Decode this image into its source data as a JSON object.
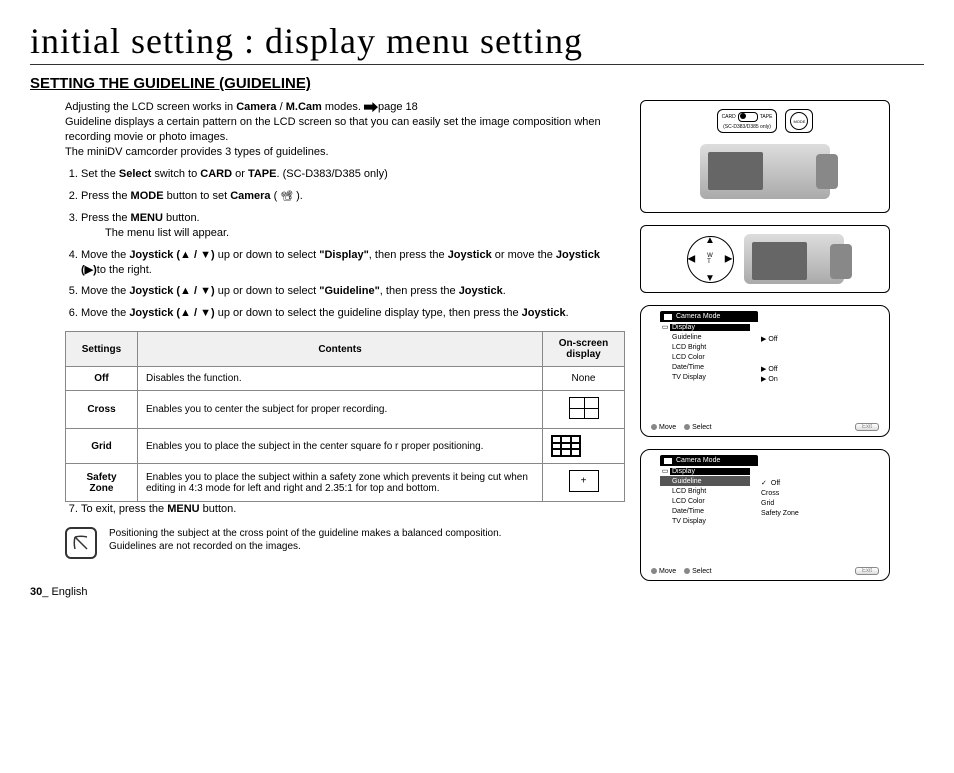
{
  "page_title": "initial setting : display menu setting",
  "section_title": "SETTING THE GUIDELINE (GUIDELINE)",
  "intro": {
    "l1a": "Adjusting the LCD screen works in ",
    "l1b": "Camera",
    "l1c": " / ",
    "l1d": "M.Cam",
    "l1e": " modes. ",
    "l1f": "page 18",
    "l2": "Guideline displays a certain pattern on the LCD screen so that you can easily set the image composition when recording movie or photo images.",
    "l3": "The miniDV camcorder provides 3 types of guidelines."
  },
  "steps": {
    "s1a": "Set the ",
    "s1b": "Select",
    "s1c": " switch to ",
    "s1d": "CARD",
    "s1e": " or ",
    "s1f": "TAPE",
    "s1g": ". (SC-D383/D385 only)",
    "s2a": "Press the ",
    "s2b": "MODE",
    "s2c": " button to set ",
    "s2d": "Camera",
    "s2e": " ( ",
    "s2f": " ).",
    "s3a": "Press the ",
    "s3b": "MENU",
    "s3c": " button.",
    "s3sub": "The menu list will appear.",
    "s4a": "Move the ",
    "s4b": "Joystick (▲ / ▼)",
    "s4c": " up or down to select ",
    "s4d": "\"Display\"",
    "s4e": ", then press the ",
    "s4f": "Joystick",
    "s4g": " or move the ",
    "s4h": "Joystick (▶)",
    "s4i": "to the right.",
    "s5a": "Move the ",
    "s5b": "Joystick (▲ / ▼)",
    "s5c": " up or down to select ",
    "s5d": "\"Guideline\"",
    "s5e": ", then press the ",
    "s5f": "Joystick",
    "s5g": ".",
    "s6a": "Move the ",
    "s6b": "Joystick (▲ / ▼)",
    "s6c": " up or down to select the guideline display type, then press the ",
    "s6d": "Joystick",
    "s6e": ".",
    "s7a": "To exit, press the ",
    "s7b": "MENU",
    "s7c": " button."
  },
  "table": {
    "h1": "Settings",
    "h2": "Contents",
    "h3": "On-screen display",
    "r1s": "Off",
    "r1c": "Disables the function.",
    "r1d": "None",
    "r2s": "Cross",
    "r2c": "Enables you to center the subject for proper recording.",
    "r3s": "Grid",
    "r3c": "Enables you to place the subject in the center square fo r proper positioning.",
    "r4s": "Safety Zone",
    "r4c": "Enables you to place the subject within a safety zone which prevents it being cut when editing in 4:3 mode for left and right and 2.35:1 for top and bottom."
  },
  "note": {
    "l1": "Positioning the subject at the cross point of the guideline makes a balanced composition.",
    "l2": "Guidelines are not recorded on the images."
  },
  "footer": {
    "page": "30",
    "sep": "_ ",
    "lang": "English"
  },
  "callouts": {
    "card": "CARD",
    "tape": "TAPE",
    "model": "(SC-D383/D385 only)",
    "mode": "MODE"
  },
  "menu1": {
    "title": "Camera Mode",
    "items": [
      "Display",
      "Guideline",
      "LCD Bright",
      "LCD Color",
      "Date/Time",
      "TV Display"
    ],
    "values": [
      {
        "label": "Off",
        "pre": "▶"
      },
      {
        "label": "Off",
        "pre": "▶"
      },
      {
        "label": "On",
        "pre": "▶"
      }
    ],
    "move": "Move",
    "select": "Select",
    "exit": "Exit"
  },
  "menu2": {
    "title": "Camera Mode",
    "items": [
      "Display",
      "Guideline",
      "LCD Bright",
      "LCD Color",
      "Date/Time",
      "TV Display"
    ],
    "values": [
      {
        "label": "Off",
        "pre": "✓"
      },
      {
        "label": "Cross"
      },
      {
        "label": "Grid"
      },
      {
        "label": "Safety Zone"
      }
    ],
    "move": "Move",
    "select": "Select",
    "exit": "Exit"
  }
}
